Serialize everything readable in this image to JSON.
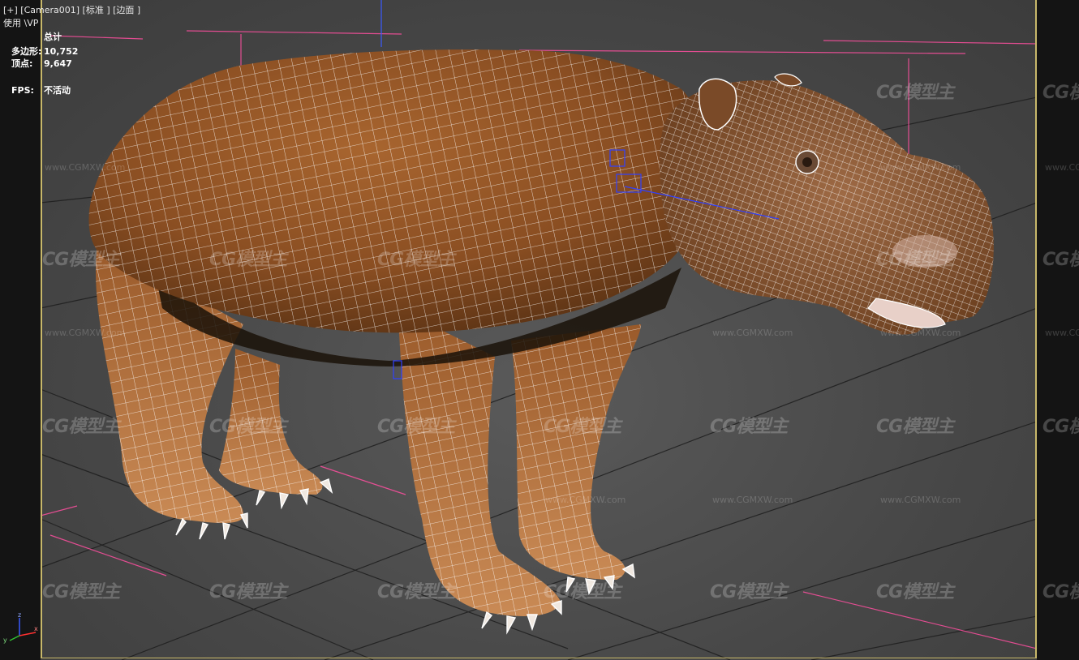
{
  "viewport": {
    "label": "[+] [Camera001] [标准 ] [边面 ]",
    "sublabel": "使用 \\VP"
  },
  "stats": {
    "title": "总计",
    "polys_label": "多边形:",
    "polys_value": "10,752",
    "verts_label": "顶点:",
    "verts_value": "9,647",
    "fps_label": "FPS:",
    "fps_value": "不活动"
  },
  "watermark": {
    "logo_text": "CG模型主",
    "url_text": "www.CGMXW.com"
  },
  "gizmo": {
    "x": "x",
    "y": "y",
    "z": "z"
  },
  "colors": {
    "frame": "#c8b86a",
    "fur": "#9a5a2a",
    "wire": "#ffffff",
    "grid": "#1a1a1a",
    "guide": "#ff4fa0"
  }
}
